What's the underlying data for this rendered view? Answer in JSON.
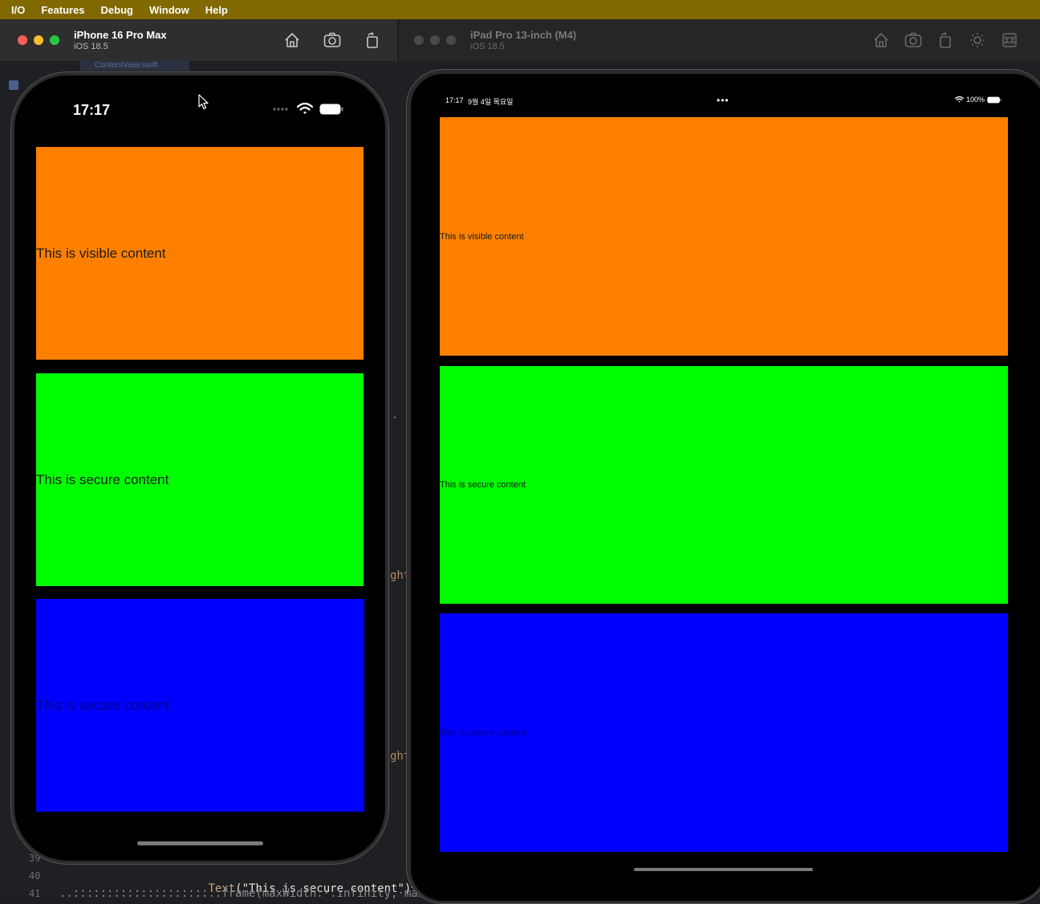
{
  "menubar": {
    "items": [
      "I/O",
      "Features",
      "Debug",
      "Window",
      "Help"
    ],
    "background": "#826800"
  },
  "simulators": {
    "left": {
      "name": "iPhone 16 Pro Max",
      "os": "iOS 18.5",
      "toolbar_icons": [
        "home-icon",
        "screenshot-icon",
        "rotate-icon"
      ]
    },
    "right": {
      "name": "iPad Pro 13-inch (M4)",
      "os": "iOS 18.5",
      "toolbar_icons": [
        "home-icon",
        "screenshot-icon",
        "rotate-icon",
        "appearance-icon",
        "command-icon"
      ]
    }
  },
  "iphone": {
    "status_time": "17:17",
    "blocks": [
      {
        "label": "This is visible content",
        "color": "#ff8000"
      },
      {
        "label": "This is secure content",
        "color": "#00ff00"
      },
      {
        "label": "This is secure content",
        "color": "#0000ff"
      }
    ]
  },
  "ipad": {
    "status_time": "17:17",
    "status_date": "9월 4일 목요일",
    "battery": "100%",
    "blocks": [
      {
        "label": "This is visible content",
        "color": "#ff8000"
      },
      {
        "label": "This is secure content",
        "color": "#00ff00"
      },
      {
        "label": "This is secure content",
        "color": "#0000ff"
      }
    ]
  },
  "xcode": {
    "tab_label": "ContentView.swift",
    "code_fragment_right_1": "ght",
    "code_fragment_right_2": "ght",
    "dots_fragment": ". .",
    "line_39": "39",
    "line_40": "40",
    "line_41": "41",
    "line_40_prefix": "....................",
    "line_40_fn": "Text",
    "line_40_string": "(\"This is secure content\")¬",
    "line_41_text": "........................frame(maxWidth:·.infinity,·maxHeigh"
  },
  "traffic_colors": {
    "close": "#ff5f57",
    "minimize": "#febc2e",
    "zoom": "#28c840",
    "inactive": "#4a4a4c"
  }
}
